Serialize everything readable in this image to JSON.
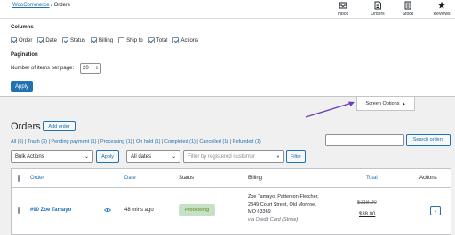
{
  "breadcrumb": {
    "parent": "WooCommerce",
    "separator": "/",
    "current": "Orders"
  },
  "top_icons": [
    {
      "icon": "inbox-icon",
      "label": "Inbox"
    },
    {
      "icon": "orders-icon",
      "label": "Orders"
    },
    {
      "icon": "stock-icon",
      "label": "Stock"
    },
    {
      "icon": "reviews-icon",
      "label": "Reviews"
    }
  ],
  "screen_options": {
    "columns_heading": "Columns",
    "columns": [
      {
        "label": "Order",
        "checked": true
      },
      {
        "label": "Date",
        "checked": true
      },
      {
        "label": "Status",
        "checked": true
      },
      {
        "label": "Billing",
        "checked": true
      },
      {
        "label": "Ship to",
        "checked": false
      },
      {
        "label": "Total",
        "checked": true
      },
      {
        "label": "Actions",
        "checked": true
      }
    ],
    "pagination_heading": "Pagination",
    "items_per_page_label": "Number of items per page:",
    "items_per_page_value": "20",
    "apply_label": "Apply",
    "tab_label": "Screen Options",
    "tab_arrow": "▲"
  },
  "page": {
    "title": "Orders",
    "add_order_label": "Add order"
  },
  "views": [
    {
      "label": "All",
      "count": "(6)"
    },
    {
      "label": "Trash",
      "count": "(3)"
    },
    {
      "label": "Pending payment",
      "count": "(1)"
    },
    {
      "label": "Processing",
      "count": "(1)"
    },
    {
      "label": "On hold",
      "count": "(1)"
    },
    {
      "label": "Completed",
      "count": "(1)"
    },
    {
      "label": "Cancelled",
      "count": "(1)"
    },
    {
      "label": "Refunded",
      "count": "(1)"
    }
  ],
  "views_separator": "|",
  "filters": {
    "bulk_actions": "Bulk Actions",
    "apply_label": "Apply",
    "all_dates": "All dates",
    "customer_placeholder": "Filter by registered customer",
    "filter_label": "Filter",
    "search_label": "Search orders"
  },
  "table": {
    "headers": {
      "order": "Order",
      "date": "Date",
      "status": "Status",
      "billing": "Billing",
      "total": "Total",
      "actions": "Actions"
    },
    "rows": [
      {
        "order": "#90 Zoe Tamayo",
        "date": "48 mins ago",
        "status": "Processing",
        "billing_lines": [
          "Zoe Tamayo, Patterson-Fletcher,",
          "2349 Court Street, Old Monroe,",
          "MO 63369"
        ],
        "billing_via": "via Credit Card (Stripe)",
        "total_old": "$218.00",
        "total_new": "$38.00"
      }
    ]
  },
  "colors": {
    "accent": "#2271b1",
    "annotation_arrow": "#6a3fb5",
    "status_bg": "#c6e1c6",
    "status_fg": "#5b841b"
  }
}
